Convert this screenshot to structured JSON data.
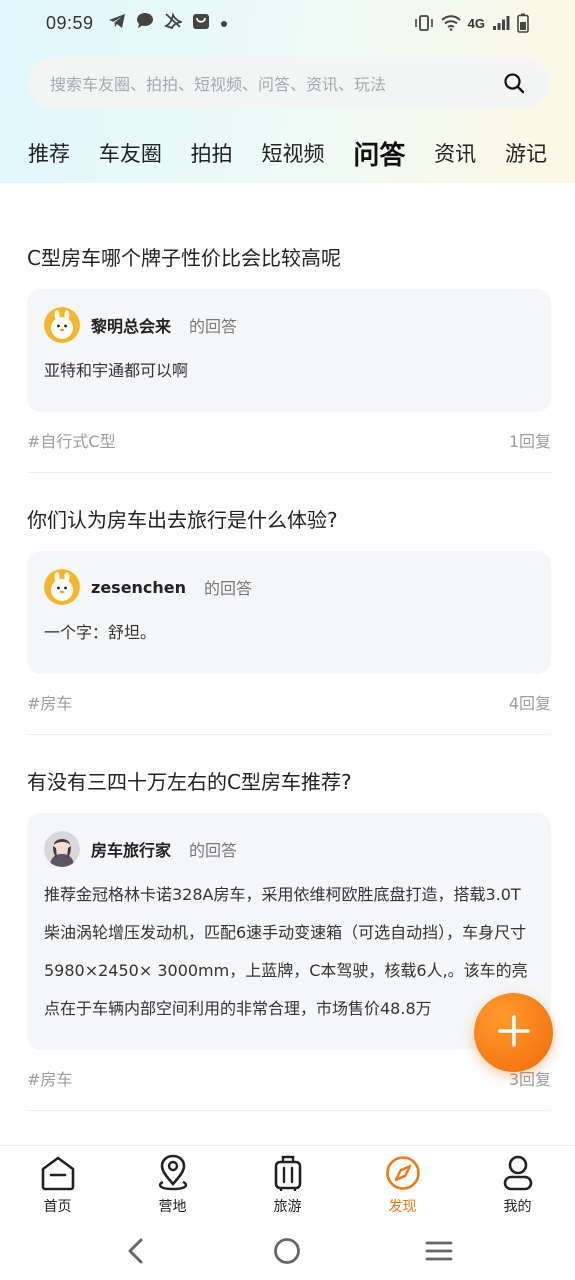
{
  "status_bar": {
    "time": "09:59",
    "left_icons": [
      "telegram-icon",
      "chat-bubble-icon",
      "muted-bird-icon",
      "shopping-bag-icon",
      "dot-icon"
    ],
    "network": "4G",
    "right_icons": [
      "vibrate-icon",
      "wifi-icon",
      "signal-icon",
      "battery-icon"
    ]
  },
  "search": {
    "placeholder": "搜索车友圈、拍拍、短视频、问答、资讯、玩法",
    "icon": "search-icon"
  },
  "tabs": [
    {
      "label": "推荐",
      "active": false
    },
    {
      "label": "车友圈",
      "active": false
    },
    {
      "label": "拍拍",
      "active": false
    },
    {
      "label": "短视频",
      "active": false
    },
    {
      "label": "问答",
      "active": true
    },
    {
      "label": "资讯",
      "active": false
    },
    {
      "label": "游记",
      "active": false
    }
  ],
  "posts": [
    {
      "title": "C型房车哪个牌子性价比会比较高呢",
      "author": "黎明总会来",
      "answer_suffix": "的回答",
      "answer": "亚特和宇通都可以啊",
      "tag": "#自行式C型",
      "replies": "1回复"
    },
    {
      "title": "你们认为房车出去旅行是什么体验?",
      "author": "zesenchen",
      "answer_suffix": "的回答",
      "answer": "一个字：舒坦。",
      "tag": "#房车",
      "replies": "4回复"
    },
    {
      "title": "有没有三四十万左右的C型房车推荐?",
      "author": "房车旅行家",
      "answer_suffix": "的回答",
      "answer": "推荐金冠格林卡诺328A房车，采用依维柯欧胜底盘打造，搭载3.0T柴油涡轮增压发动机，匹配6速手动变速箱（可选自动挡），车身尺寸5980×2450× 3000mm，上蓝牌，C本驾驶，核载6人,。该车的亮点在于车辆内部空间利用的非常合理，市场售价48.8万",
      "tag": "#房车",
      "replies": "3回复"
    }
  ],
  "fab": {
    "icon": "plus-icon",
    "color": "#f26b0a"
  },
  "bottom_nav": [
    {
      "label": "首页",
      "icon": "home-icon",
      "active": false
    },
    {
      "label": "营地",
      "icon": "location-pin-icon",
      "active": false
    },
    {
      "label": "旅游",
      "icon": "luggage-icon",
      "active": false
    },
    {
      "label": "发现",
      "icon": "compass-icon",
      "active": true
    },
    {
      "label": "我的",
      "icon": "user-icon",
      "active": false
    }
  ],
  "colors": {
    "accent": "#f07818",
    "tab_highlight": "#7fd6f5",
    "card_bg": "#f5f6f7"
  },
  "system_nav": [
    "back-icon",
    "home-circle-icon",
    "menu-icon"
  ]
}
